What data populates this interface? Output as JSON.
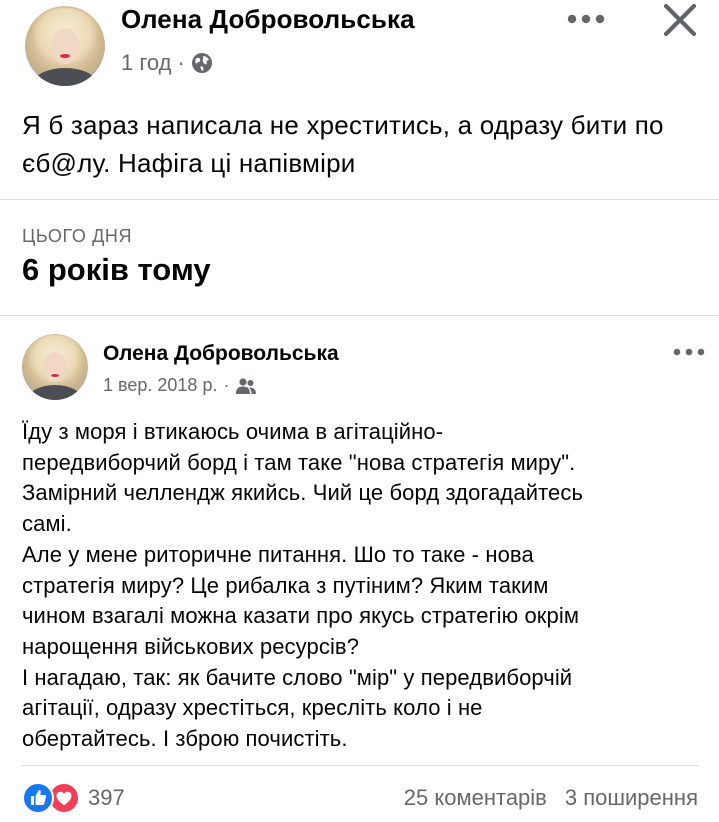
{
  "post": {
    "author": "Олена Добровольська",
    "time": "1 год",
    "separator": "·",
    "privacy_icon": "globe-icon",
    "text": "Я б зараз написала не хреститись, а одразу бити по єб@лу. Нафіга ці напівміри"
  },
  "header_actions": {
    "more_icon": "more-dots-icon",
    "close_icon": "close-icon"
  },
  "memory": {
    "label": "ЦЬОГО ДНЯ",
    "title": "6 років тому",
    "post": {
      "author": "Олена Добровольська",
      "date": "1 вер. 2018 р.",
      "separator": "·",
      "audience_icon": "friends-icon",
      "more_icon": "more-dots-icon",
      "text": "Їду з моря і втикаюсь очима в агітаційно-\nпередвиборчий борд і там таке \"нова стратегія миру\".\nЗамірний челлендж якийсь. Чий це борд здогадайтесь\nсамі.\nАле у мене риторичне питання. Шо то таке - нова\nстратегія миру? Це рибалка з путіним? Яким таким\nчином взагалі можна казати про якусь стратегію окрім\nнарощення військових ресурсів?\nІ нагадаю, так: як бачите слово \"мір\" у передвиборчій\nагітації, одразу хрестіться, кресліть коло і не\nобертайтесь. І зброю почистіть."
    }
  },
  "footer": {
    "reaction_icons": [
      "like-icon",
      "love-icon"
    ],
    "reaction_count": "397",
    "comments": "25 коментарів",
    "shares": "3 поширення"
  },
  "colors": {
    "like": "#1877f2",
    "love": "#f33e58",
    "secondary_text": "#65676b"
  }
}
